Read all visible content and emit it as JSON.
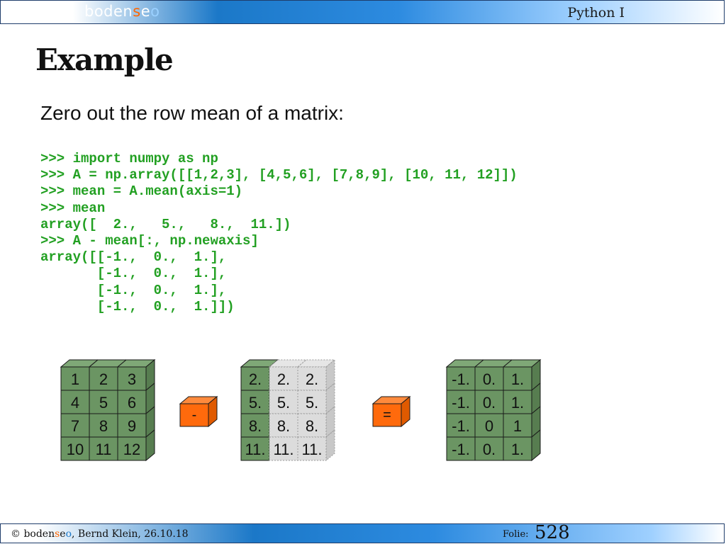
{
  "header": {
    "brand_main": "boden",
    "brand_s": "s",
    "brand_e": "e",
    "brand_o": "o",
    "course": "Python I"
  },
  "slide": {
    "title": "Example",
    "subtitle": "Zero out the row mean of a matrix:",
    "code_lines": [
      ">>> import numpy as np",
      ">>> A = np.array([[1,2,3], [4,5,6], [7,8,9], [10, 11, 12]])",
      ">>> mean = A.mean(axis=1)",
      ">>> mean",
      "array([  2.,   5.,   8.,  11.])",
      ">>> A - mean[:, np.newaxis]",
      "array([[-1.,  0.,  1.],",
      "       [-1.,  0.,  1.],",
      "       [-1.,  0.,  1.],",
      "       [-1.,  0.,  1.]])"
    ]
  },
  "diagram": {
    "matrix_a": [
      [
        "1",
        "2",
        "3"
      ],
      [
        "4",
        "5",
        "6"
      ],
      [
        "7",
        "8",
        "9"
      ],
      [
        "10",
        "11",
        "12"
      ]
    ],
    "minus_op": "-",
    "matrix_mean": [
      [
        "2.",
        "2.",
        "2."
      ],
      [
        "5.",
        "5.",
        "5."
      ],
      [
        "8.",
        "8.",
        "8."
      ],
      [
        "11.",
        "11.",
        "11."
      ]
    ],
    "equals_op": "=",
    "matrix_result": [
      [
        "-1.",
        "0.",
        "1."
      ],
      [
        "-1.",
        "0.",
        "1."
      ],
      [
        "-1.",
        "0",
        "1"
      ],
      [
        "-1.",
        "0.",
        "1."
      ]
    ],
    "colors": {
      "cube_face": "#6b9563",
      "cube_top": "#7fa877",
      "cube_side": "#577d50",
      "ghost_face": "#dcdcdc",
      "ghost_side": "#c8c8c8",
      "operator": "#ff6a0c",
      "code_green": "#22a022"
    }
  },
  "footer": {
    "copyright": "©",
    "brand_main": "boden",
    "brand_s": "s",
    "brand_e": "e",
    "brand_o": "o",
    "author_date": ", Bernd Klein, 26.10.18",
    "folie_label": "Folie:",
    "folie_number": "528"
  }
}
